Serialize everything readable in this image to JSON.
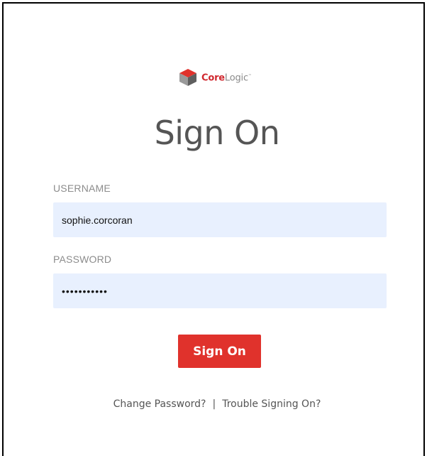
{
  "logo": {
    "word_core": "Core",
    "word_logic": "Logic",
    "tm": "™",
    "colors": {
      "core": "#d0282f",
      "logic": "#8a8a8a"
    }
  },
  "page_title": "Sign On",
  "form": {
    "username_label": "USERNAME",
    "username_value": "sophie.corcoran",
    "password_label": "PASSWORD",
    "password_value": "•••••••••••",
    "submit_label": "Sign On"
  },
  "footer": {
    "change_password": "Change Password?",
    "separator": "|",
    "trouble_signing_on": "Trouble Signing On?"
  },
  "colors": {
    "accent": "#e0322c",
    "field_background": "#e8f0fe",
    "title_text": "#555555",
    "label_text": "#8c8c8c"
  }
}
